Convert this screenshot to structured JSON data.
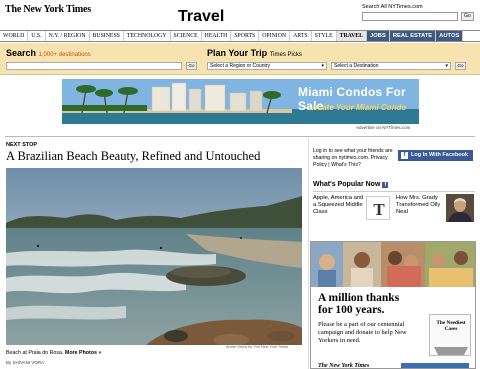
{
  "masthead": {
    "logo": "The New York Times",
    "section": "Travel",
    "search_label": "Search All NYTimes.com",
    "search_go": "Go"
  },
  "nav": [
    {
      "label": "WORLD"
    },
    {
      "label": "U.S."
    },
    {
      "label": "N.Y. / REGION"
    },
    {
      "label": "BUSINESS"
    },
    {
      "label": "TECHNOLOGY"
    },
    {
      "label": "SCIENCE"
    },
    {
      "label": "HEALTH"
    },
    {
      "label": "SPORTS"
    },
    {
      "label": "OPINION"
    },
    {
      "label": "ARTS"
    },
    {
      "label": "STYLE"
    },
    {
      "label": "TRAVEL",
      "active": true
    },
    {
      "label": "JOBS",
      "dark": true
    },
    {
      "label": "REAL ESTATE",
      "dark": true
    },
    {
      "label": "AUTOS",
      "dark": true
    }
  ],
  "search_bar": {
    "title": "Search",
    "subtitle": "1,000+ destinations",
    "go": "Go",
    "plan_title": "Plan Your Trip",
    "plan_subtitle": "Times Picks",
    "region_select": "Select a Region or Country",
    "destination_select": "Select a Destination",
    "plan_go": "Go"
  },
  "ad": {
    "headline": "Miami Condos For Sale",
    "subline": "Locate Your Miami Condo",
    "caption": "Advertise on NYTimes.com"
  },
  "article": {
    "kicker": "NEXT STOP",
    "headline": "A Brazilian Beach Beauty, Refined and Untouched",
    "caption": "Beach at Praia do Rosa.",
    "more_photos": "More Photos »",
    "byline": "By SHIVANI VORA",
    "photo_credit": "Andre Vieira for The New York Times"
  },
  "sidebar": {
    "login_text": "Log in to see what your friends are sharing on nytimes.com. Privacy Policy | What's This?",
    "fb_button": "Log In With Facebook",
    "popular_title": "What's Popular Now",
    "popular": [
      {
        "title": "Apple, America and a Squeezed Middle Class"
      },
      {
        "title": "How Mrs. Grady Transformed Olly Neal"
      }
    ]
  },
  "promo": {
    "headline_1": "A million thanks",
    "headline_2": "for 100 years.",
    "body": "Please be a part of our centennial campaign and donate to help New Yorkers in need.",
    "logo_text": "The Neediest Cases",
    "footer_logo": "The New York Times"
  },
  "colors": {
    "search_bar_bg": "#f6e3b0",
    "search_accent": "#c94f00",
    "facebook": "#3b5998",
    "nav_dark": "#3d5a80"
  }
}
